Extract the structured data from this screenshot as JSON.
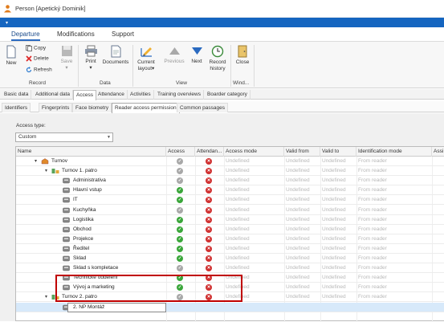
{
  "window": {
    "title": "Person [Apetický Dominik]",
    "icon": "person-app-icon"
  },
  "ribbon_tabs": [
    "Departure",
    "Modifications",
    "Support"
  ],
  "ribbon": {
    "record": {
      "new": "New",
      "copy": "Copy",
      "delete": "Delete",
      "refresh": "Refresh",
      "save": "Save",
      "group": "Record"
    },
    "data": {
      "print": "Print",
      "documents": "Documents",
      "group": "Data"
    },
    "view": {
      "current_layout": "Current layout",
      "previous": "Previous",
      "next": "Next",
      "record_history": "Record history",
      "group": "View"
    },
    "window": {
      "close": "Close",
      "group": "Wind..."
    }
  },
  "main_tabs": [
    "Basic data",
    "Additional data",
    "Access",
    "Attendance",
    "Activities",
    "Training overviews",
    "Boarder category"
  ],
  "main_tab_active": "Access",
  "sub_tabs": [
    "Identifiers",
    "Fingerprints",
    "Face biometry",
    "Reader access permission",
    "Common passages"
  ],
  "sub_tab_active": "Reader access permission",
  "access_type": {
    "label": "Access type:",
    "value": "Custom"
  },
  "grid": {
    "columns": [
      "Name",
      "Access",
      "Attendan...",
      "Access mode",
      "Valid from",
      "Valid to",
      "Identification mode",
      "Assi"
    ],
    "undefined_text": "Undefined",
    "from_reader_text": "From reader",
    "rows": [
      {
        "name": "Turnov",
        "level": 0,
        "kind": "building",
        "access": "grey",
        "attend": "red"
      },
      {
        "name": "Turnov 1. patro",
        "level": 1,
        "kind": "floor",
        "access": "grey",
        "attend": "red"
      },
      {
        "name": "Administrativa",
        "level": 2,
        "kind": "reader",
        "access": "grey",
        "attend": "red"
      },
      {
        "name": "Hlavní vstup",
        "level": 2,
        "kind": "reader",
        "access": "green",
        "attend": "red"
      },
      {
        "name": "IT",
        "level": 2,
        "kind": "reader",
        "access": "green",
        "attend": "red"
      },
      {
        "name": "Kuchyňka",
        "level": 2,
        "kind": "reader",
        "access": "grey",
        "attend": "red"
      },
      {
        "name": "Logistika",
        "level": 2,
        "kind": "reader",
        "access": "green",
        "attend": "red"
      },
      {
        "name": "Obchod",
        "level": 2,
        "kind": "reader",
        "access": "green",
        "attend": "red"
      },
      {
        "name": "Projekce",
        "level": 2,
        "kind": "reader",
        "access": "green",
        "attend": "red"
      },
      {
        "name": "Ředitel",
        "level": 2,
        "kind": "reader",
        "access": "green",
        "attend": "red"
      },
      {
        "name": "Sklad",
        "level": 2,
        "kind": "reader",
        "access": "green",
        "attend": "red"
      },
      {
        "name": "Sklad s kompletace",
        "level": 2,
        "kind": "reader",
        "access": "grey",
        "attend": "red"
      },
      {
        "name": "Technické oddělení",
        "level": 2,
        "kind": "reader",
        "access": "green",
        "attend": "red"
      },
      {
        "name": "Vývoj a marketing",
        "level": 2,
        "kind": "reader",
        "access": "green",
        "attend": "red"
      },
      {
        "name": "Turnov 2. patro",
        "level": 1,
        "kind": "floor",
        "access": "grey",
        "attend": "red"
      },
      {
        "name": "2. NP Montáž",
        "level": 2,
        "kind": "reader",
        "access": "",
        "attend": "",
        "editing": true
      }
    ]
  },
  "colors": {
    "accent": "#1565c0",
    "highlight_box": "#c00000",
    "selected_row": "#d7e9fa"
  }
}
